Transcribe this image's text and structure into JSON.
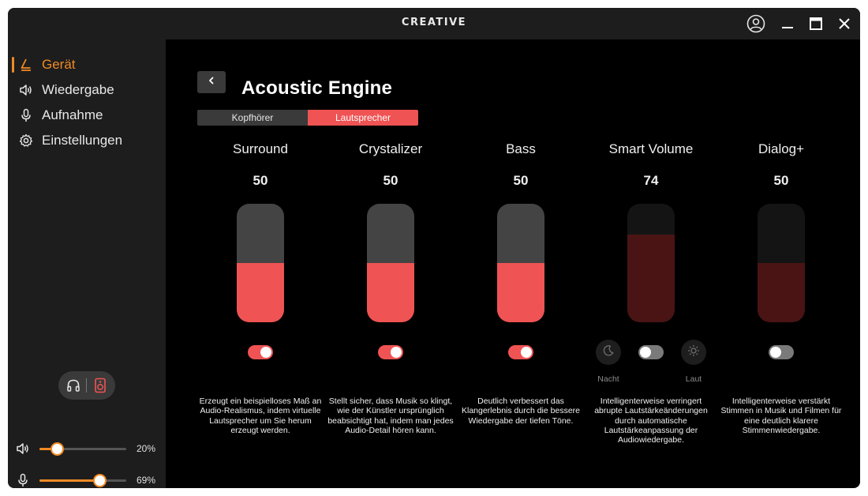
{
  "app": {
    "brand": "CREATIVE"
  },
  "window_controls": [
    "account-icon",
    "minimize-icon",
    "maximize-icon",
    "close-icon"
  ],
  "sidebar": {
    "items": [
      {
        "label": "Gerät",
        "icon": "device-icon",
        "active": true
      },
      {
        "label": "Wiedergabe",
        "icon": "speaker-icon",
        "active": false
      },
      {
        "label": "Aufnahme",
        "icon": "microphone-icon",
        "active": false
      },
      {
        "label": "Einstellungen",
        "icon": "gear-icon",
        "active": false
      }
    ],
    "output_devices": {
      "options": [
        "headphones-icon",
        "speaker-box-icon"
      ],
      "selected": "speaker-box-icon"
    },
    "playback_volume": {
      "icon": "speaker-icon",
      "value": 20,
      "label": "20%"
    },
    "mic_volume": {
      "icon": "microphone-icon",
      "value": 69,
      "label": "69%"
    }
  },
  "main": {
    "title": "Acoustic Engine",
    "tabs": [
      {
        "label": "Kopfhörer",
        "selected": false
      },
      {
        "label": "Lautsprecher",
        "selected": true
      }
    ],
    "effects": [
      {
        "name": "Surround",
        "value": "50",
        "level": 50,
        "enabled": true,
        "description": "Erzeugt ein beispielloses Maß an Audio-Realismus, indem virtuelle Lautsprecher um Sie herum erzeugt werden."
      },
      {
        "name": "Crystalizer",
        "value": "50",
        "level": 50,
        "enabled": true,
        "description": "Stellt sicher, dass Musik so klingt, wie der Künstler ursprünglich beabsichtigt hat, indem man jedes Audio-Detail hören kann."
      },
      {
        "name": "Bass",
        "value": "50",
        "level": 50,
        "enabled": true,
        "description": "Deutlich verbessert das Klangerlebnis durch die bessere Wiedergabe der tiefen Töne."
      },
      {
        "name": "Smart Volume",
        "value": "74",
        "level": 74,
        "enabled": false,
        "description": "Intelligenterweise verringert abrupte Lautstärkeänderungen durch automatische Lautstärkeanpassung der Audiowiedergabe.",
        "modes": {
          "night": {
            "label": "Nacht",
            "icon": "moon-icon"
          },
          "loud": {
            "label": "Laut",
            "icon": "sun-icon"
          }
        }
      },
      {
        "name": "Dialog+",
        "value": "50",
        "level": 50,
        "enabled": false,
        "description": "Intelligenterweise verstärkt Stimmen in Musik und Filmen für eine deutlich klarere Stimmenwiedergabe."
      }
    ]
  },
  "colors": {
    "accent_orange": "#f08a24",
    "accent_red": "#ef5353",
    "disabled_red": "#4a1414"
  }
}
